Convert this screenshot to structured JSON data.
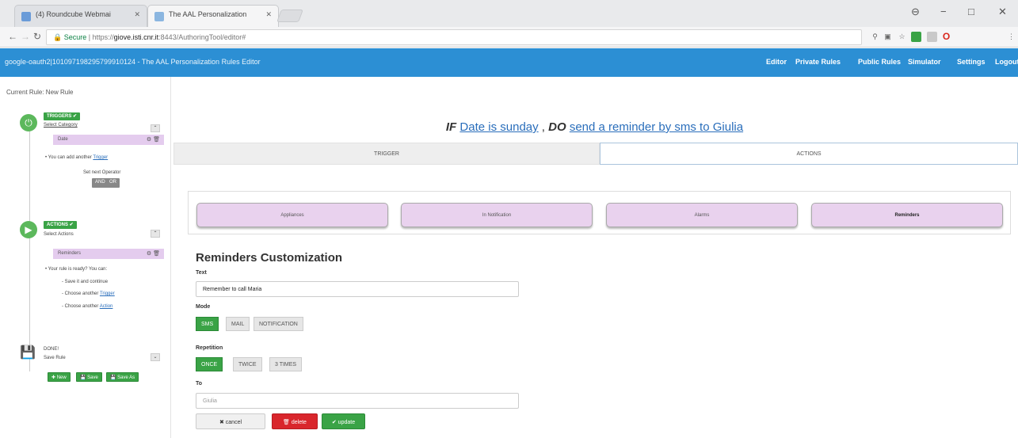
{
  "browser": {
    "tabs": [
      {
        "label": "(4) Roundcube Webmai"
      },
      {
        "label": "The AAL Personalization"
      }
    ],
    "url": {
      "secure_label": "Secure",
      "prefix": "https://",
      "host": "giove.isti.cnr.it",
      "path": ":8443/AuthoringTool/editor#"
    },
    "window_controls": [
      "−",
      "□",
      "✕"
    ]
  },
  "app": {
    "title": "google-oauth2|101097198295799910124 - The AAL Personalization Rules Editor",
    "nav": [
      "Editor",
      "Private Rules",
      "Public Rules",
      "Simulator",
      "Settings",
      "Logout"
    ]
  },
  "sidebar": {
    "title": "Current Rule: New Rule",
    "trigger": {
      "tag": "TRIGGERS ✔",
      "link": "Select Category",
      "item": "Date",
      "hint_prefix": "• You can add another",
      "hint_link": "Trigger",
      "operator_label": "Set next Operator",
      "operators": [
        "AND",
        "OR"
      ]
    },
    "action": {
      "tag": "ACTIONS ✔",
      "sub": "Select Actions",
      "item": "Reminders",
      "hint": "• Your rule is ready? You can:",
      "options": [
        {
          "prefix": "- Save it and continue",
          "link": ""
        },
        {
          "prefix": "- Choose another",
          "link": "Trigger"
        },
        {
          "prefix": "- Choose another",
          "link": "Action"
        }
      ]
    },
    "save": {
      "title": "DONE!",
      "sub": "Save Rule",
      "buttons": [
        "✚ New",
        "💾 Save",
        "💾 Save As"
      ]
    }
  },
  "main": {
    "rule": {
      "if_kw": "IF",
      "trigger_text": "Date is sunday",
      "sep": " , ",
      "do_kw": "DO",
      "action_text": "send a reminder by sms to Giulia"
    },
    "tabs": [
      "TRIGGER",
      "ACTIONS"
    ],
    "categories": [
      "Appliances",
      "In Notification",
      "Alarms",
      "Reminders"
    ],
    "form": {
      "heading": "Reminders Customization",
      "text_label": "Text",
      "text_value": "Remember to call Maria",
      "mode_label": "Mode",
      "modes": [
        "SMS",
        "MAIL",
        "NOTIFICATION"
      ],
      "repetition_label": "Repetition",
      "repetitions": [
        "ONCE",
        "TWICE",
        "3 TIMES"
      ],
      "to_label": "To",
      "to_placeholder": "Giulia",
      "buttons": {
        "cancel": "✖ cancel",
        "delete": "🗑 delete",
        "update": "✔ update"
      }
    }
  }
}
